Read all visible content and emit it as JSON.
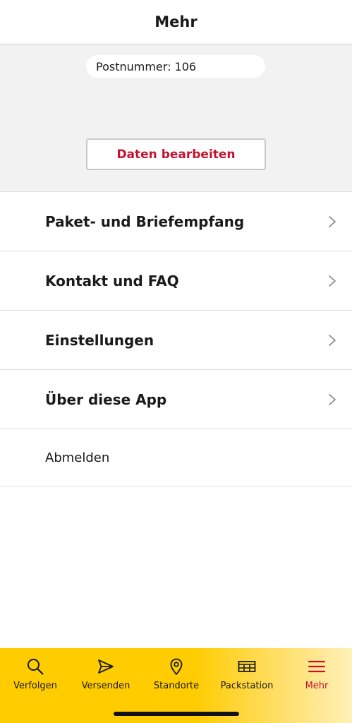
{
  "header": {
    "title": "Mehr"
  },
  "profile": {
    "postnummer": "Postnummer: 106",
    "edit_label": "Daten bearbeiten"
  },
  "menu": {
    "items": [
      {
        "label": "Paket- und Briefempfang"
      },
      {
        "label": "Kontakt und FAQ"
      },
      {
        "label": "Einstellungen"
      },
      {
        "label": "Über diese App"
      }
    ],
    "logout_label": "Abmelden"
  },
  "tabbar": {
    "tabs": [
      {
        "label": "Verfolgen",
        "icon": "search-icon"
      },
      {
        "label": "Versenden",
        "icon": "send-icon"
      },
      {
        "label": "Standorte",
        "icon": "location-pin-icon"
      },
      {
        "label": "Packstation",
        "icon": "packstation-icon"
      },
      {
        "label": "Mehr",
        "icon": "menu-icon",
        "active": true
      }
    ]
  },
  "colors": {
    "brand_yellow": "#ffcc00",
    "brand_red": "#c8102e"
  }
}
